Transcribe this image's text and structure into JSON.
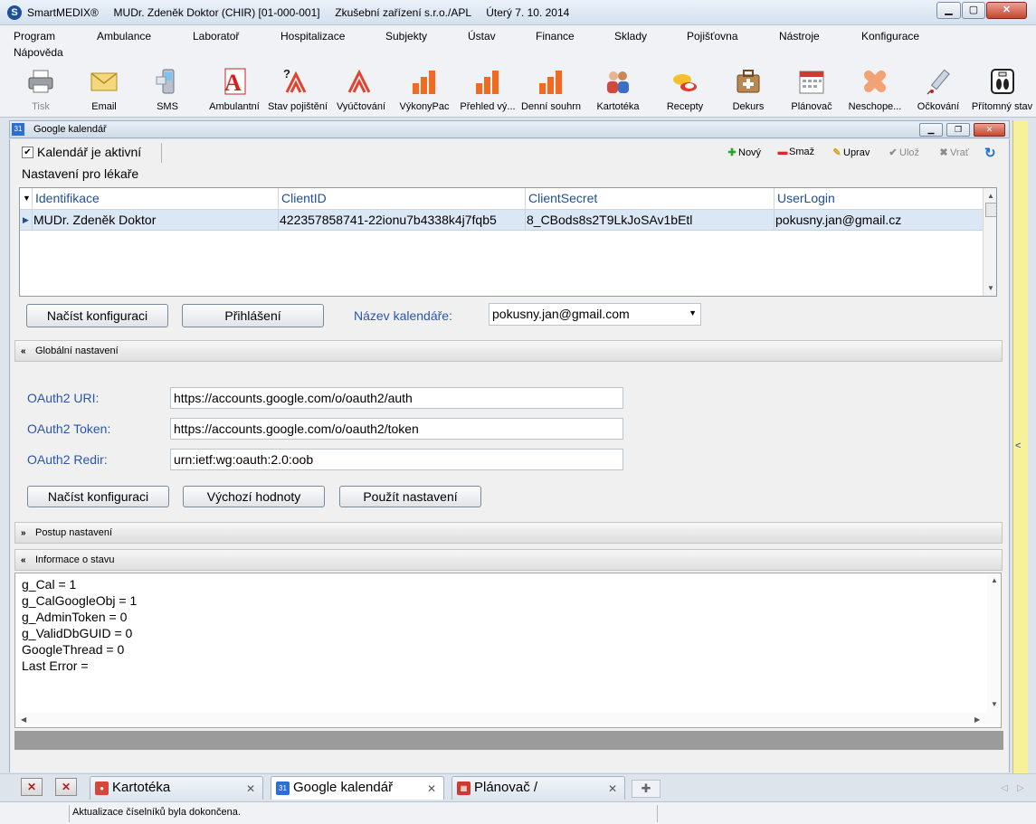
{
  "window": {
    "app_name": "SmartMEDIX®",
    "user": "MUDr. Zdeněk Doktor (CHIR) [01-000-001]",
    "facility": "Zkušební zařízení s.r.o./APL",
    "date": "Úterý 7. 10. 2014"
  },
  "menu": [
    "Program",
    "Ambulance",
    "Laboratoř",
    "Hospitalizace",
    "Subjekty",
    "Ústav",
    "Finance",
    "Sklady",
    "Pojišťovna",
    "Nástroje",
    "Konfigurace",
    "Nápověda"
  ],
  "toolbar": [
    {
      "label": "Tisk",
      "icon": "printer-icon",
      "disabled": true
    },
    {
      "label": "Email",
      "icon": "envelope-icon"
    },
    {
      "label": "SMS",
      "icon": "phone-icon"
    },
    {
      "label": "Ambulantní",
      "icon": "ambulance-letter-icon"
    },
    {
      "label": "Stav pojištění",
      "icon": "insurance-status-icon"
    },
    {
      "label": "Vyúčtování",
      "icon": "billing-icon"
    },
    {
      "label": "VýkonyPac",
      "icon": "bar-chart-icon"
    },
    {
      "label": "Přehled vý...",
      "icon": "bar-chart-icon"
    },
    {
      "label": "Denní souhrn",
      "icon": "bar-chart-icon"
    },
    {
      "label": "Kartotéka",
      "icon": "patients-icon"
    },
    {
      "label": "Recepty",
      "icon": "pills-icon"
    },
    {
      "label": "Dekurs",
      "icon": "medical-bag-icon"
    },
    {
      "label": "Plánovač",
      "icon": "calendar-icon"
    },
    {
      "label": "Neschope...",
      "icon": "bandage-icon"
    },
    {
      "label": "Očkování",
      "icon": "syringe-icon"
    },
    {
      "label": "Přítomný stav",
      "icon": "scale-icon"
    }
  ],
  "colors": {
    "accent_blue": "#2b56a8",
    "header_blue": "#1f4e9a",
    "selection": "#dbe7f5",
    "yellow_strip": "#f7f29a"
  },
  "inner_window": {
    "title": "Google kalendář"
  },
  "calendar_active": {
    "label": "Kalendář je aktivní",
    "checked": true
  },
  "actions": {
    "new": "Nový",
    "delete": "Smaž",
    "edit": "Uprav",
    "save": "Ulož",
    "revert": "Vrať"
  },
  "doctor_settings": {
    "group_label": "Nastavení pro lékaře",
    "columns": [
      "Identifikace",
      "ClientID",
      "ClientSecret",
      "UserLogin"
    ],
    "rows": [
      {
        "identifikace": "MUDr. Zdeněk Doktor",
        "client_id": "422357858741-22ionu7b4338k4j7fqb5",
        "client_secret": "8_CBods8s2T9LkJoSAv1bEtl",
        "user_login": "pokusny.jan@gmail.cz"
      }
    ],
    "btn_load": "Načíst konfiguraci",
    "btn_login": "Přihlášení",
    "calendar_name_label": "Název kalendáře:",
    "calendar_name_value": "pokusny.jan@gmail.com"
  },
  "global_settings": {
    "header": "Globální nastavení",
    "uri_label": "OAuth2 URI:",
    "uri_value": "https://accounts.google.com/o/oauth2/auth",
    "token_label": "OAuth2 Token:",
    "token_value": "https://accounts.google.com/o/oauth2/token",
    "redir_label": "OAuth2 Redir:",
    "redir_value": "urn:ietf:wg:oauth:2.0:oob",
    "btn_load": "Načíst konfiguraci",
    "btn_defaults": "Výchozí hodnoty",
    "btn_apply": "Použít nastavení"
  },
  "procedure": {
    "header": "Postup nastavení"
  },
  "status_info": {
    "header": "Informace o stavu",
    "lines": [
      "g_Cal = 1",
      "g_CalGoogleObj = 1",
      "g_AdminToken = 0",
      "g_ValidDbGUID = 0",
      "GoogleThread = 0",
      "Last Error ="
    ]
  },
  "tabs": [
    {
      "label": "Kartotéka",
      "icon": "patients-icon",
      "active": false
    },
    {
      "label": "Google kalendář",
      "icon": "calendar-31-icon",
      "active": true
    },
    {
      "label": "Plánovač /",
      "icon": "calendar-icon",
      "active": false
    }
  ],
  "statusbar": {
    "message": "Aktualizace číselníků byla dokončena."
  }
}
